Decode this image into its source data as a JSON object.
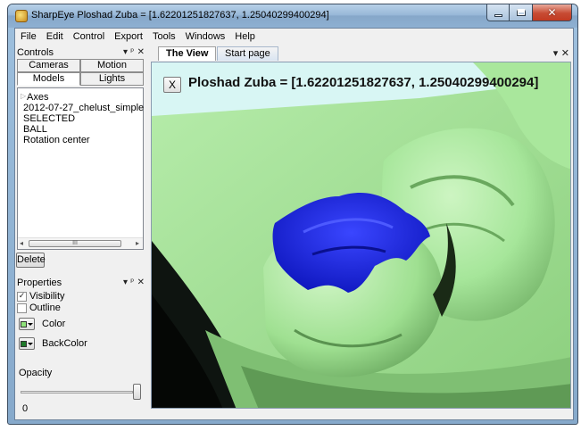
{
  "window": {
    "title": "SharpEye Ploshad Zuba = [1.62201251827637, 1.25040299400294]",
    "close_glyph": "✕"
  },
  "menu": [
    {
      "label": "File"
    },
    {
      "label": "Edit"
    },
    {
      "label": "Control"
    },
    {
      "label": "Export"
    },
    {
      "label": "Tools"
    },
    {
      "label": "Windows"
    },
    {
      "label": "Help"
    }
  ],
  "controls_panel": {
    "title": "Controls",
    "pin_glyph": "▾ ᵖ ✕",
    "tabs_top": [
      "Cameras",
      "Motion"
    ],
    "tabs_bottom": [
      "Models",
      "Lights"
    ],
    "active_tab": "Models",
    "tree_items": [
      "Axes",
      "2012-07-27_chelust_simple",
      "SELECTED",
      "BALL",
      "Rotation center"
    ],
    "scroll_thumb_glyph": "III",
    "delete_label": "Delete"
  },
  "properties_panel": {
    "title": "Properties",
    "pin_glyph": "▾ ᵖ ✕",
    "visibility_label": "Visibility",
    "visibility_checked": true,
    "outline_label": "Outline",
    "outline_checked": false,
    "color_label": "Color",
    "color_swatch": "#8fe27a",
    "backcolor_label": "BackColor",
    "backcolor_swatch": "#1f7a2a",
    "opacity_label": "Opacity",
    "opacity_value": 1.0
  },
  "document_tabs": {
    "tabs": [
      "The View",
      "Start page"
    ],
    "active": "The View",
    "icons": "▾ ✕"
  },
  "viewport": {
    "close_label": "X",
    "overlay_text": "Ploshad Zuba = [1.62201251827637, 1.25040299400294]",
    "model_color": "#a6e69a",
    "selection_color": "#1a24d6",
    "background_color": "#d8f6f4"
  },
  "status": {
    "text": "0"
  }
}
